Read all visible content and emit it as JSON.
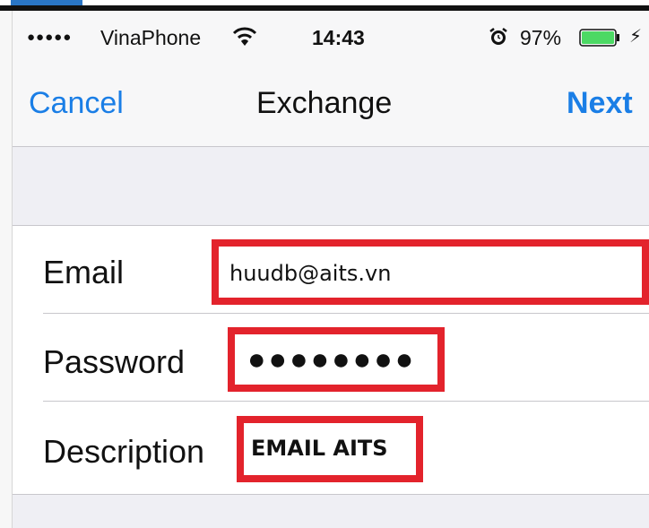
{
  "status_bar": {
    "signal": "●●●●●",
    "carrier": "VinaPhone",
    "time": "14:43",
    "battery_percent": "97%",
    "charge_symbol": "⚡"
  },
  "nav": {
    "cancel_label": "Cancel",
    "title": "Exchange",
    "next_label": "Next"
  },
  "form": {
    "email_label": "Email",
    "email_value": "huudb@aits.vn",
    "password_label": "Password",
    "password_value": "●●●●●●●●",
    "description_label": "Description",
    "description_value": "EMAIL AITS"
  },
  "icons": {
    "wifi": "wifi-icon",
    "alarm": "alarm-icon",
    "battery": "battery-icon"
  },
  "colors": {
    "accent": "#1a7ee6",
    "highlight": "#e3232c",
    "battery_fill": "#4cd964"
  }
}
